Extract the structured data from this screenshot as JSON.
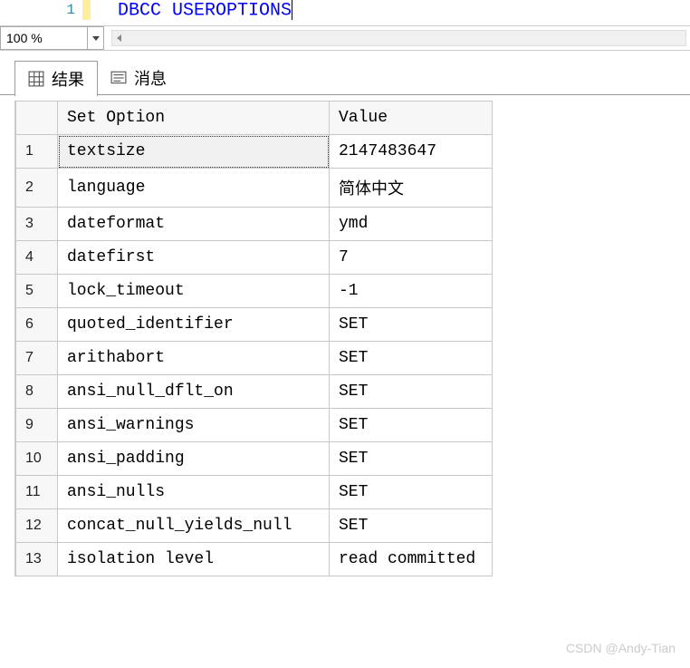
{
  "editor": {
    "line_number": "1",
    "sql_text": "DBCC USEROPTIONS"
  },
  "zoom": {
    "value": "100 %"
  },
  "tabs": {
    "results_label": "结果",
    "messages_label": "消息"
  },
  "grid": {
    "columns": [
      "Set Option",
      "Value"
    ],
    "rows": [
      {
        "n": "1",
        "option": "textsize",
        "value": "2147483647",
        "selected": true
      },
      {
        "n": "2",
        "option": "language",
        "value": "简体中文",
        "selected": false
      },
      {
        "n": "3",
        "option": "dateformat",
        "value": "ymd",
        "selected": false
      },
      {
        "n": "4",
        "option": "datefirst",
        "value": "7",
        "selected": false
      },
      {
        "n": "5",
        "option": "lock_timeout",
        "value": "-1",
        "selected": false
      },
      {
        "n": "6",
        "option": "quoted_identifier",
        "value": "SET",
        "selected": false
      },
      {
        "n": "7",
        "option": "arithabort",
        "value": "SET",
        "selected": false
      },
      {
        "n": "8",
        "option": "ansi_null_dflt_on",
        "value": "SET",
        "selected": false
      },
      {
        "n": "9",
        "option": "ansi_warnings",
        "value": "SET",
        "selected": false
      },
      {
        "n": "10",
        "option": "ansi_padding",
        "value": "SET",
        "selected": false
      },
      {
        "n": "11",
        "option": "ansi_nulls",
        "value": "SET",
        "selected": false
      },
      {
        "n": "12",
        "option": "concat_null_yields_null",
        "value": "SET",
        "selected": false
      },
      {
        "n": "13",
        "option": "isolation level",
        "value": "read committed",
        "selected": false
      }
    ]
  },
  "watermark": "CSDN @Andy-Tian"
}
